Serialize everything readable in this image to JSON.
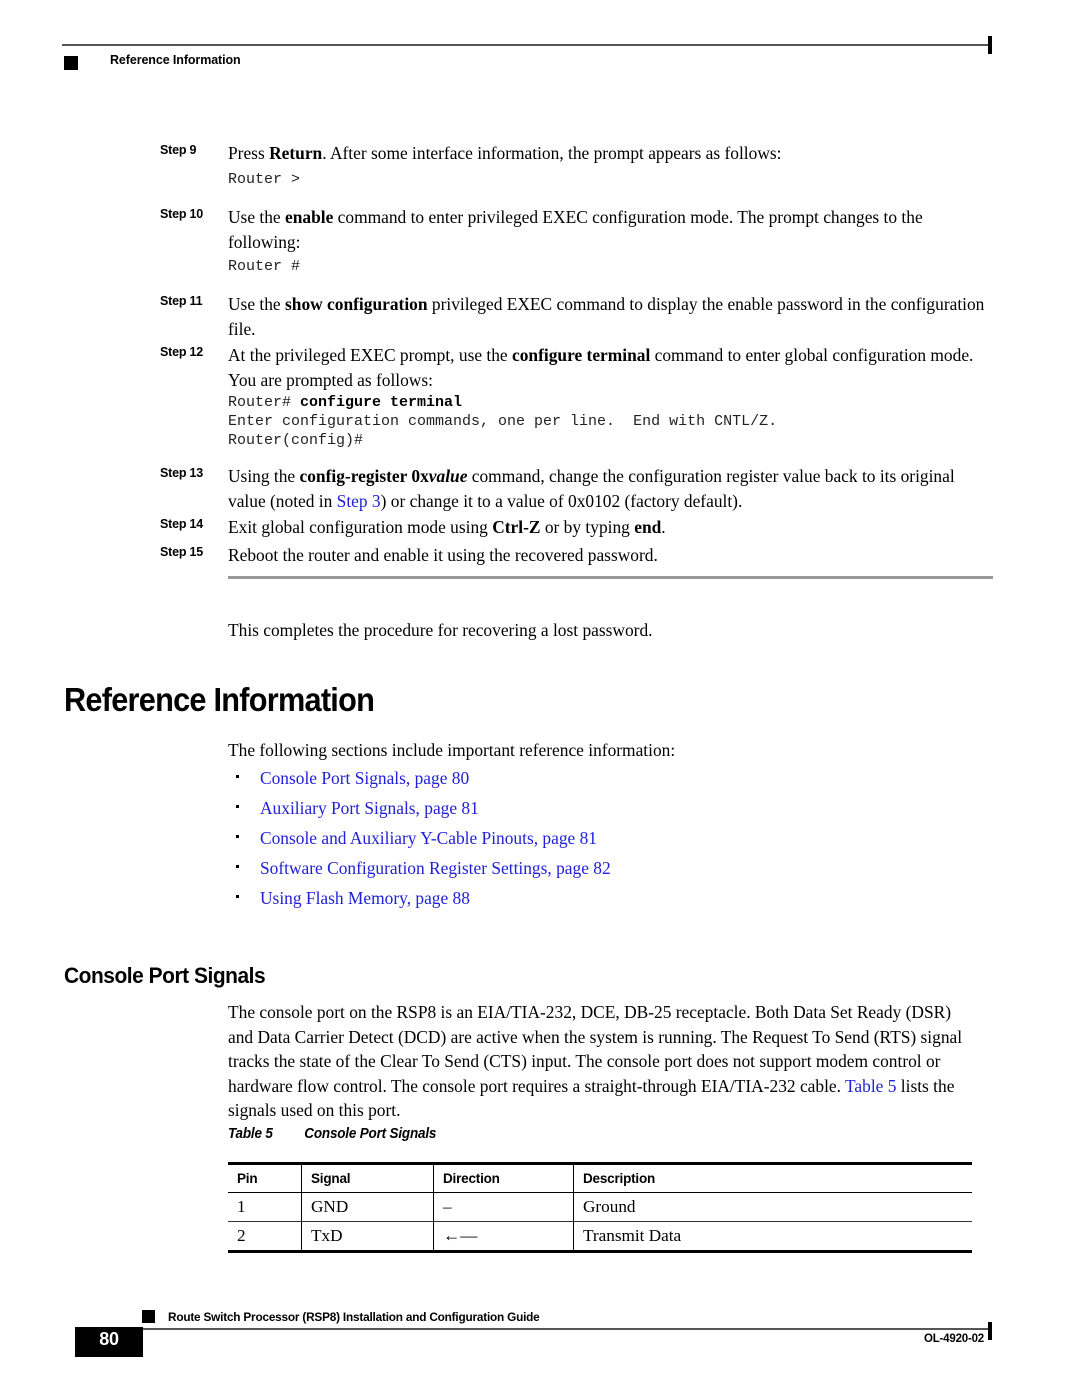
{
  "header": {
    "running_head": "Reference Information"
  },
  "steps": [
    {
      "label": "Step 9",
      "text_parts": [
        {
          "t": "Press ",
          "style": "normal"
        },
        {
          "t": "Return",
          "style": "bold"
        },
        {
          "t": ". After some interface information, the prompt appears as follows:",
          "style": "normal"
        }
      ],
      "code": "Router >"
    },
    {
      "label": "Step 10",
      "text_parts": [
        {
          "t": "Use the ",
          "style": "normal"
        },
        {
          "t": "enable",
          "style": "bold"
        },
        {
          "t": " command to enter privileged EXEC configuration mode. The prompt changes to the following:",
          "style": "normal"
        }
      ],
      "code": "Router #"
    },
    {
      "label": "Step 11",
      "text_parts": [
        {
          "t": "Use the ",
          "style": "normal"
        },
        {
          "t": "show configuration",
          "style": "bold"
        },
        {
          "t": " privileged EXEC command to display the enable password in the configuration file.",
          "style": "normal"
        }
      ],
      "code": ""
    },
    {
      "label": "Step 12",
      "text_parts": [
        {
          "t": "At the privileged EXEC prompt, use the ",
          "style": "normal"
        },
        {
          "t": "configure terminal",
          "style": "bold"
        },
        {
          "t": " command to enter global configuration mode. You are prompted as follows:",
          "style": "normal"
        }
      ],
      "code_lines": [
        {
          "plain": "Router# ",
          "bold": "configure terminal"
        },
        {
          "plain": "Enter configuration commands, one per line.  End with CNTL/Z.",
          "bold": ""
        },
        {
          "plain": "Router(config)#",
          "bold": ""
        }
      ]
    },
    {
      "label": "Step 13",
      "text_parts": [
        {
          "t": "Using the ",
          "style": "normal"
        },
        {
          "t": "config-register 0x",
          "style": "bold"
        },
        {
          "t": "value",
          "style": "bold-italic"
        },
        {
          "t": " command, change the configuration register value back to its original value (noted in ",
          "style": "normal"
        },
        {
          "t": "Step 3",
          "style": "link"
        },
        {
          "t": ") or change it to a value of 0x0102 (factory default).",
          "style": "normal"
        }
      ],
      "code": ""
    },
    {
      "label": "Step 14",
      "text_parts": [
        {
          "t": "Exit global configuration mode using ",
          "style": "normal"
        },
        {
          "t": "Ctrl-Z",
          "style": "bold"
        },
        {
          "t": " or by typing ",
          "style": "normal"
        },
        {
          "t": "end",
          "style": "bold"
        },
        {
          "t": ".",
          "style": "normal"
        }
      ],
      "code": ""
    },
    {
      "label": "Step 15",
      "text_parts": [
        {
          "t": "Reboot the router and enable it using the recovered password.",
          "style": "normal"
        }
      ],
      "code": ""
    }
  ],
  "closing_paragraph": "This completes the procedure for recovering a lost password.",
  "section": {
    "heading": "Reference Information",
    "intro": "The following sections include important reference information:",
    "links": [
      "Console Port Signals, page 80",
      "Auxiliary Port Signals, page 81",
      "Console and Auxiliary Y-Cable Pinouts, page 81",
      "Software Configuration Register Settings, page 82",
      "Using Flash Memory, page 88"
    ]
  },
  "subsection": {
    "heading": "Console Port Signals",
    "paragraph_parts": [
      {
        "t": "The console port on the RSP8 is an EIA/TIA-232, DCE, DB-25 receptacle. Both Data Set Ready (DSR) and Data Carrier Detect (DCD) are active when the system is running. The Request To Send (RTS) signal tracks the state of the Clear To Send (CTS) input. The console port does not support modem control or hardware flow control. The console port requires a straight-through EIA/TIA-232 cable. ",
        "style": "normal"
      },
      {
        "t": "Table 5",
        "style": "link"
      },
      {
        "t": " lists the signals used on this port.",
        "style": "normal"
      }
    ]
  },
  "table": {
    "caption_number": "Table 5",
    "caption_title": "Console Port Signals",
    "columns": [
      "Pin",
      "Signal",
      "Direction",
      "Description"
    ],
    "rows": [
      [
        "1",
        "GND",
        "–",
        "Ground"
      ],
      [
        "2",
        "TxD",
        "←—",
        "Transmit Data"
      ]
    ]
  },
  "footer": {
    "guide_title": "Route Switch Processor (RSP8) Installation and Configuration Guide",
    "page_number": "80",
    "document_id": "OL-4920-02"
  },
  "colors": {
    "link": "#2020d8",
    "text": "#000000",
    "rule": "#9a9a9a"
  }
}
